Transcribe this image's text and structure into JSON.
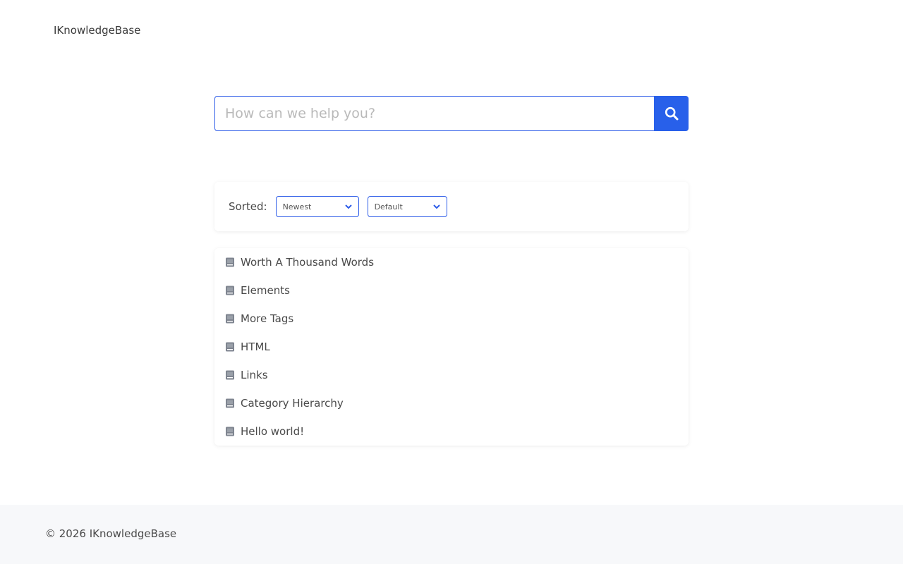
{
  "header": {
    "site_title": "IKnowledgeBase"
  },
  "search": {
    "placeholder": "How can we help you?",
    "value": ""
  },
  "sort": {
    "label": "Sorted:",
    "order_selected": "Newest",
    "type_selected": "Default"
  },
  "articles": [
    {
      "title": "Worth A Thousand Words"
    },
    {
      "title": "Elements"
    },
    {
      "title": "More Tags"
    },
    {
      "title": "HTML"
    },
    {
      "title": "Links"
    },
    {
      "title": "Category Hierarchy"
    },
    {
      "title": "Hello world!"
    }
  ],
  "footer": {
    "copyright": "© 2026 IKnowledgeBase"
  },
  "icons": {
    "search_button": "search-icon",
    "article": "book-icon",
    "select": "chevron-down-icon"
  },
  "colors": {
    "accent": "#2860ea",
    "footer_bg": "#f7f8fa"
  }
}
